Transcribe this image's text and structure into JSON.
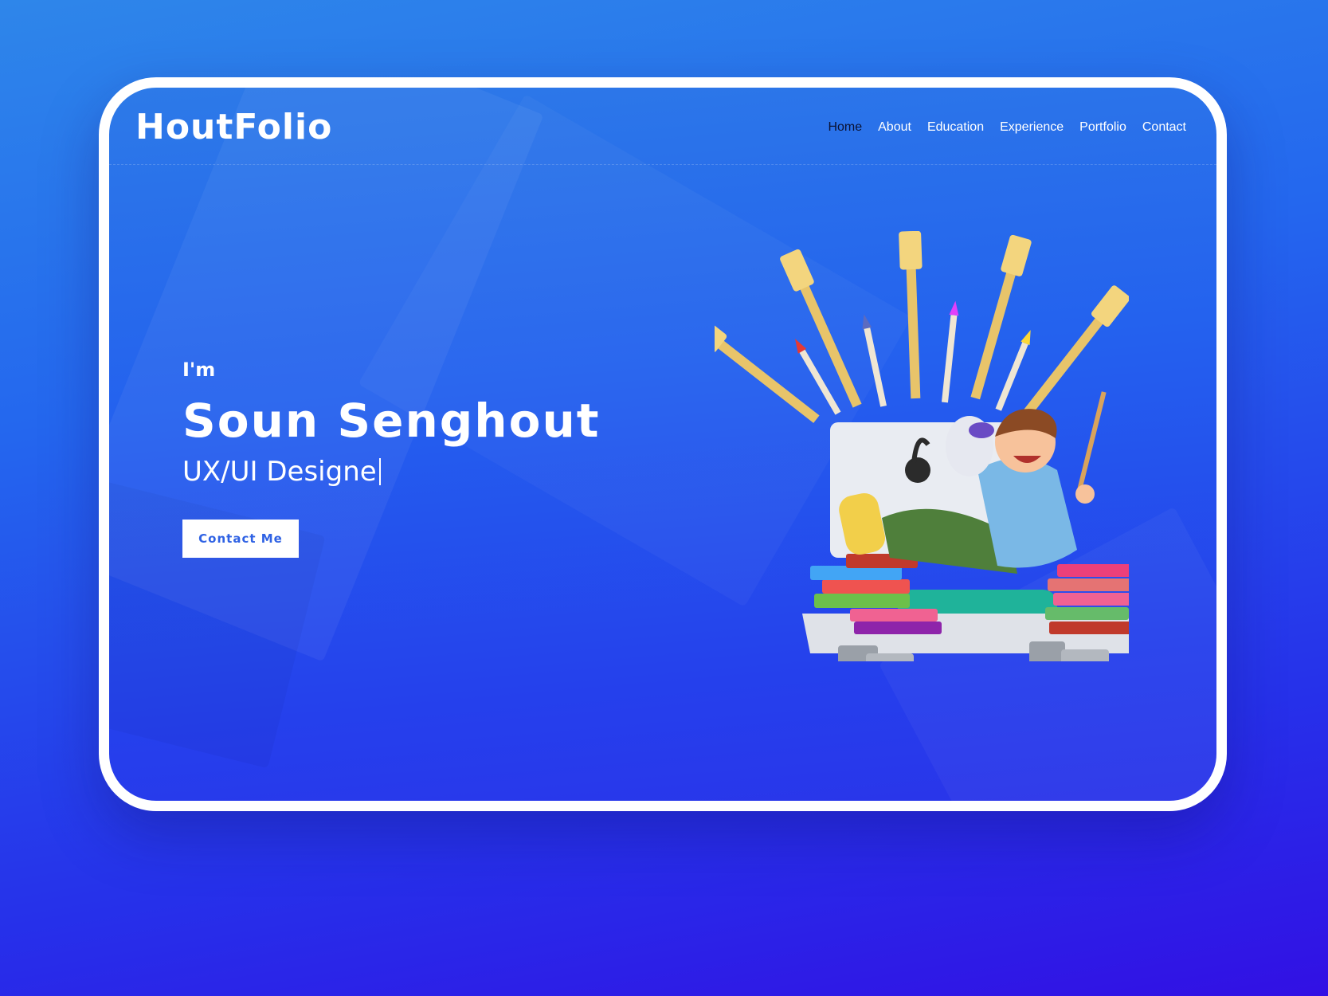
{
  "brand": {
    "logo": "HoutFolio"
  },
  "nav": {
    "items": [
      {
        "label": "Home",
        "active": true
      },
      {
        "label": "About"
      },
      {
        "label": "Education"
      },
      {
        "label": "Experience"
      },
      {
        "label": "Portfolio"
      },
      {
        "label": "Contact"
      }
    ]
  },
  "hero": {
    "greeting": "I'm",
    "name": "Soun Senghout",
    "role": "UX/UI Designe",
    "cta_label": "Contact Me"
  },
  "colors": {
    "accent": "#2f62e4",
    "background_top": "#2e86ea",
    "background_bottom": "#3210e4",
    "nav_active": "#0a1233"
  },
  "icons": [
    "hero-illustration"
  ]
}
